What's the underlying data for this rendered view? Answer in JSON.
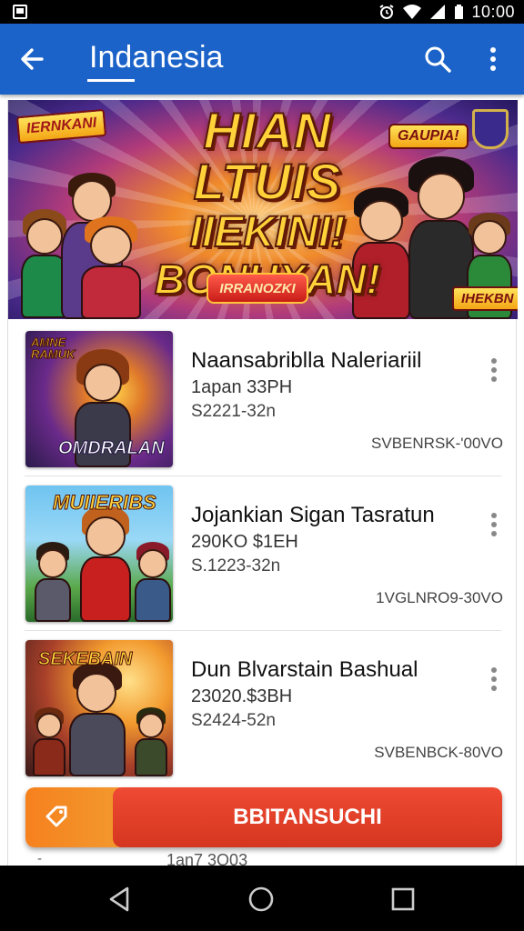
{
  "status_bar": {
    "time": "10:00",
    "icons": [
      "gallery-icon",
      "alarm-icon",
      "wifi-icon",
      "signal-icon",
      "battery-icon"
    ]
  },
  "app_bar": {
    "title": "Indanesia",
    "background": "#1b63c9",
    "icons": [
      "back-arrow-icon",
      "search-icon",
      "more-vert-icon"
    ]
  },
  "banner": {
    "tag_left": "IERNKANI",
    "headline_1": "HIAN LTUIS",
    "headline_2": "IIEKINI!",
    "headline_3": "BONUXAN!",
    "tag_right": "GAUPIA!",
    "cta": "IRRANOZKI",
    "tag_bottom": "IHEKBN"
  },
  "items": [
    {
      "thumb_label": "OMDRALAN",
      "thumb_top_label": "AMNE RAMUK",
      "title": "Naansabriblla Naleriariil",
      "line1": "1apan 33PH",
      "line2": "S2221-32n",
      "meta": "SVBENRSK-'00VO"
    },
    {
      "thumb_label": "MUIIERIBS",
      "title": "Jojankian Sigan Tasratun",
      "line1": "290KO $1EH",
      "line2": "S.1223-32n",
      "meta": "1VGLNRO9-30VO"
    },
    {
      "thumb_label": "SEKEBAIN",
      "title": "Dun Blvarstain Bashual",
      "line1": "23020.$3BH",
      "line2": "S2424-52n",
      "meta": "SVBENBCK-80VO"
    }
  ],
  "action_bar": {
    "label": "BBITANSUCHI",
    "icon": "tag-icon",
    "left_color": "#f6811e",
    "right_color": "#e2402a"
  },
  "peek": {
    "left_text": "-",
    "text": "1an7 3Q03"
  },
  "nav_bar": {
    "icons": [
      "back-triangle-icon",
      "home-circle-icon",
      "recents-square-icon"
    ]
  }
}
